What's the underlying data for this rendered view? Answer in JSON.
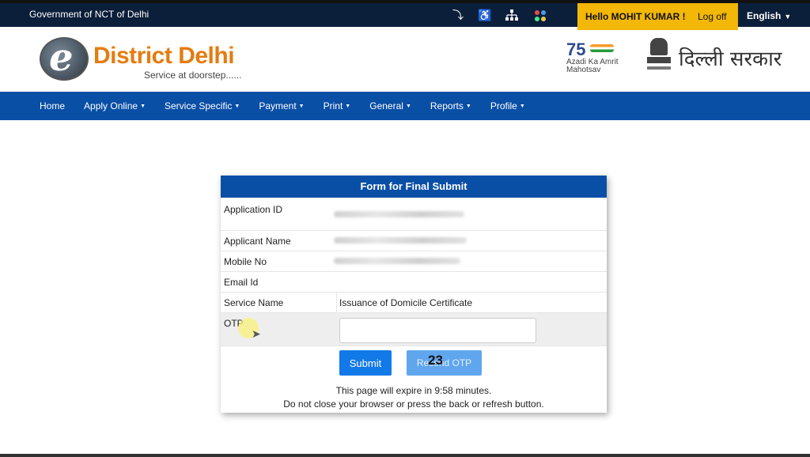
{
  "topbar": {
    "gov_text": "Government of NCT of Delhi",
    "icons": [
      "skip-to-content-icon",
      "accessibility-icon",
      "sitemap-icon",
      "apps-icon"
    ],
    "hello_text": "Hello MOHIT KUMAR !",
    "logoff_label": "Log off",
    "language_label": "English"
  },
  "header": {
    "logo_title": "District Delhi",
    "logo_subtitle": "Service at doorstep......",
    "azadi_number": "75",
    "azadi_text": "Azadi Ka Amrit Mahotsav",
    "delhi_sarkar": "दिल्ली सरकार"
  },
  "nav": {
    "items": [
      {
        "label": "Home",
        "dropdown": false
      },
      {
        "label": "Apply Online",
        "dropdown": true
      },
      {
        "label": "Service Specific",
        "dropdown": true
      },
      {
        "label": "Payment",
        "dropdown": true
      },
      {
        "label": "Print",
        "dropdown": true
      },
      {
        "label": "General",
        "dropdown": true
      },
      {
        "label": "Reports",
        "dropdown": true
      },
      {
        "label": "Profile",
        "dropdown": true
      }
    ]
  },
  "form": {
    "title": "Form for Final Submit",
    "application_id_label": "Application ID",
    "applicant_name_label": "Applicant Name",
    "mobile_label": "Mobile No",
    "email_label": "Email Id",
    "service_name_label": "Service Name",
    "service_name_value": "Issuance of Domicile Certificate",
    "otp_label": "OTP",
    "otp_value": "",
    "submit_label": "Submit",
    "resend_label": "Resend OTP",
    "resend_countdown": "23",
    "expire_text": "This page will expire in 9:58 minutes.",
    "warning_text": "Do not close your browser or press the back or refresh button."
  },
  "colors": {
    "topbar_bg": "#0b1f3a",
    "nav_bg": "#0a4fa6",
    "hello_bg": "#f2b707",
    "logo_orange": "#e57c10",
    "submit_bg": "#1279e8"
  }
}
